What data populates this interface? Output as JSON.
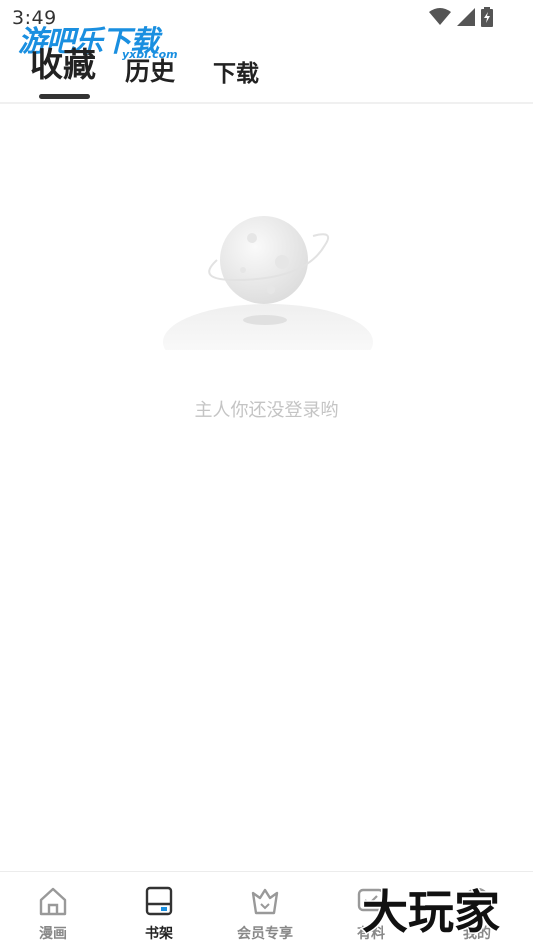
{
  "status_bar": {
    "time": "3:49"
  },
  "watermark_top": {
    "main": "游吧乐下载",
    "sub": "yxbl.com"
  },
  "tabs": [
    {
      "label": "收藏",
      "active": true
    },
    {
      "label": "历史",
      "active": false
    },
    {
      "label": "下载",
      "active": false
    }
  ],
  "empty_state": {
    "message": "主人你还没登录哟"
  },
  "bottom_nav": [
    {
      "label": "漫画",
      "icon": "home-icon",
      "active": false
    },
    {
      "label": "书架",
      "icon": "bookshelf-icon",
      "active": true
    },
    {
      "label": "会员专享",
      "icon": "vip-crown-icon",
      "active": false
    },
    {
      "label": "有料",
      "icon": "chat-icon",
      "active": false
    },
    {
      "label": "我的",
      "icon": "profile-icon",
      "active": false
    }
  ],
  "watermark_bottom": {
    "text": "大玩家"
  },
  "colors": {
    "accent": "#1a8fe0",
    "text_primary": "#222222",
    "text_muted": "#c4c4c4",
    "nav_inactive": "#888888"
  }
}
